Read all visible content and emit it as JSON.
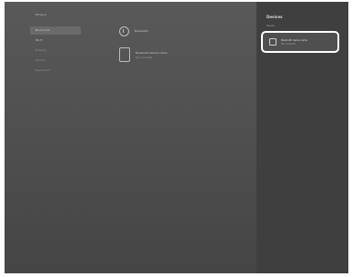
{
  "sidebar": {
    "items": [
      {
        "label": "Privacy",
        "active": false
      },
      {
        "label": "Bluetooth",
        "active": true
      },
      {
        "label": "Wi-Fi",
        "active": false
      },
      {
        "label": "Display",
        "active": false
      },
      {
        "label": "Sound",
        "active": false
      },
      {
        "label": "Keyboard",
        "active": false
      }
    ]
  },
  "main": {
    "bluetooth_row": {
      "label": "Bluetooth"
    },
    "device_row": {
      "name": "Bluetooth device name",
      "status": "Not connected"
    }
  },
  "panel": {
    "title": "Devices",
    "section_label": "Nearby",
    "selected_device": {
      "name": "Bluetooth device name",
      "status": "Not connected"
    }
  }
}
